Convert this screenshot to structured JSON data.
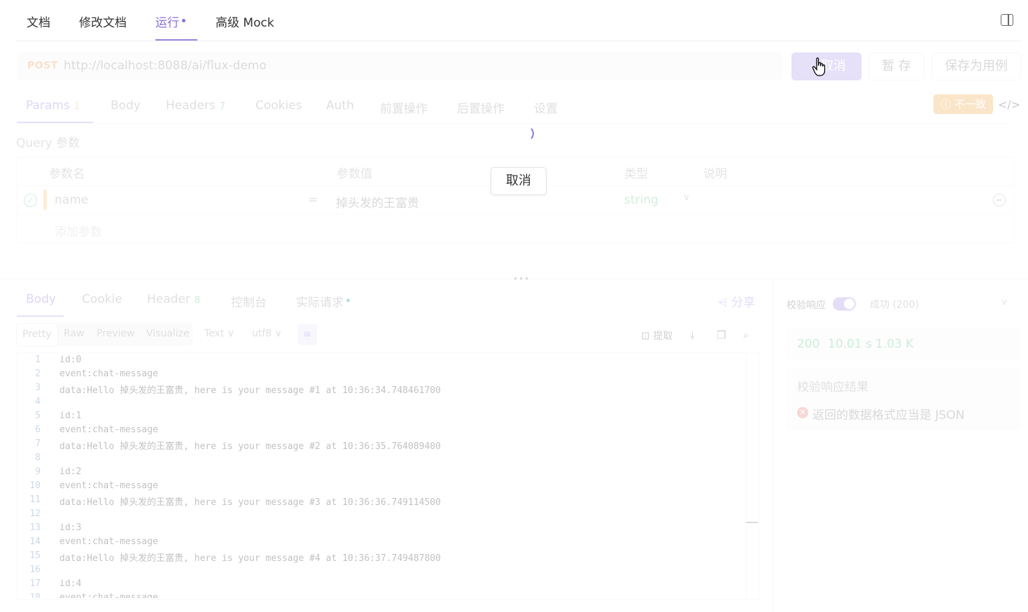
{
  "top_tabs": [
    {
      "label": "文档"
    },
    {
      "label": "修改文档"
    },
    {
      "label": "运行"
    },
    {
      "label": "高级 Mock"
    }
  ],
  "request": {
    "method": "POST",
    "url": "http://localhost:8088/ai/flux-demo",
    "cancel_label": "取消",
    "send_partial_label": "取消",
    "save_temp_label": "暂 存",
    "save_case_label": "保存为用例"
  },
  "param_tabs": [
    {
      "label": "Params",
      "badge": "1"
    },
    {
      "label": "Body"
    },
    {
      "label": "Headers",
      "badge": "7"
    },
    {
      "label": "Cookies"
    },
    {
      "label": "Auth"
    },
    {
      "label": "前置操作"
    },
    {
      "label": "后置操作"
    },
    {
      "label": "设置"
    }
  ],
  "warning_badge": "不一致",
  "query": {
    "title": "Query 参数",
    "columns": [
      "参数名",
      "参数值",
      "类型",
      "说明"
    ],
    "rows": [
      {
        "name": "name",
        "eq": "=",
        "value": "掉头发的王富贵",
        "type": "string"
      }
    ],
    "add_label": "添加参数"
  },
  "cancel_popup": "取消",
  "response_tabs": [
    {
      "label": "Body"
    },
    {
      "label": "Cookie"
    },
    {
      "label": "Header",
      "badge": "8"
    },
    {
      "label": "控制台"
    },
    {
      "label": "实际请求"
    }
  ],
  "share_label": "分享",
  "format_options": [
    "Pretty",
    "Raw",
    "Preview",
    "Visualize"
  ],
  "format_type": "Text",
  "encoding": "utf8",
  "extract_label": "提取",
  "code_lines": [
    "id:0",
    "event:chat-message",
    "data:Hello 掉头发的王富贵, here is your message #1 at 10:36:34.748461700",
    "",
    "id:1",
    "event:chat-message",
    "data:Hello 掉头发的王富贵, here is your message #2 at 10:36:35.764089400",
    "",
    "id:2",
    "event:chat-message",
    "data:Hello 掉头发的王富贵, here is your message #3 at 10:36:36.749114500",
    "",
    "id:3",
    "event:chat-message",
    "data:Hello 掉头发的王富贵, here is your message #4 at 10:36:37.749487800",
    "",
    "id:4",
    "event:chat-message"
  ],
  "validation": {
    "label": "校验响应",
    "enabled": true,
    "status_option": "成功 (200)",
    "status_code": "200",
    "time": "10.01 s",
    "size": "1.03 K",
    "result_title": "校验响应结果",
    "error": "返回的数据格式应当是 JSON"
  }
}
